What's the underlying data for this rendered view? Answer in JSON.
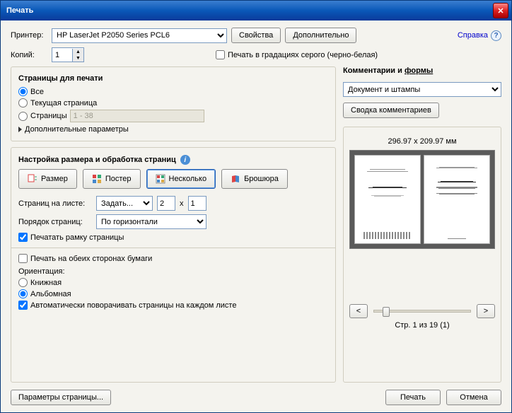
{
  "window_title": "Печать",
  "help_link": "Справка",
  "printer": {
    "label": "Принтер:",
    "selected": "HP LaserJet P2050 Series PCL6",
    "properties_btn": "Свойства",
    "advanced_btn": "Дополнительно"
  },
  "copies": {
    "label": "Копий:",
    "value": "1"
  },
  "grayscale_checkbox": "Печать в градациях серого (черно-белая)",
  "pages_group": {
    "title": "Страницы для печати",
    "all": "Все",
    "current": "Текущая страница",
    "range_label": "Страницы",
    "range_value": "1 - 38",
    "more": "Дополнительные параметры"
  },
  "size_group": {
    "title": "Настройка размера и обработка страниц",
    "tabs": {
      "size": "Размер",
      "poster": "Постер",
      "multiple": "Несколько",
      "booklet": "Брошюра"
    },
    "per_sheet_label": "Страниц на листе:",
    "per_sheet_mode": "Задать...",
    "per_sheet_x": "2",
    "per_sheet_y": "1",
    "order_label": "Порядок страниц:",
    "order_value": "По горизонтали",
    "print_border": "Печатать рамку страницы",
    "duplex": "Печать на обеих сторонах бумаги",
    "orientation_label": "Ориентация:",
    "portrait": "Книжная",
    "landscape": "Альбомная",
    "autorotate": "Автоматически поворачивать страницы на каждом листе"
  },
  "comments_group": {
    "title_a": "Комментарии и ",
    "title_b": "формы",
    "mode": "Документ и штампы",
    "summary_btn": "Сводка комментариев"
  },
  "preview": {
    "dim": "296.97 x 209.97 мм",
    "page_counter": "Стр. 1 из 19 (1)"
  },
  "footer": {
    "page_setup": "Параметры страницы...",
    "print": "Печать",
    "cancel": "Отмена"
  }
}
